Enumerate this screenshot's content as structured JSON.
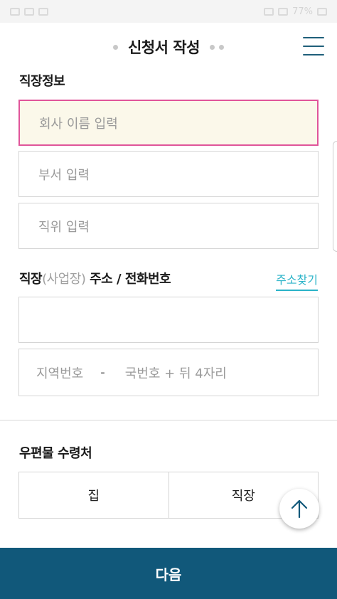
{
  "status_bar": {
    "text": "77%"
  },
  "header": {
    "title": "신청서 작성",
    "menu_icon": "hamburger-menu-icon"
  },
  "work_info": {
    "section_label": "직장정보",
    "company_placeholder": "회사 이름 입력",
    "department_placeholder": "부서 입력",
    "position_placeholder": "직위 입력"
  },
  "work_address": {
    "label_prefix": "직장",
    "label_muted": "(사업장)",
    "label_suffix": " 주소 / 전화번호",
    "search_link": "주소찾기",
    "address_value": "",
    "area_code_placeholder": "지역번호",
    "dash": "-",
    "number_placeholder": "국번호 + 뒤 4자리"
  },
  "mail_receipt": {
    "section_label": "우편물 수령처",
    "options": [
      "집",
      "직장"
    ]
  },
  "scroll_top_icon": "arrow-up-icon",
  "footer": {
    "next_label": "다음"
  },
  "colors": {
    "primary": "#11587a",
    "accent_link": "#2ab3c8",
    "focus_border": "#e0559a",
    "focus_background": "#fbf8ea"
  }
}
